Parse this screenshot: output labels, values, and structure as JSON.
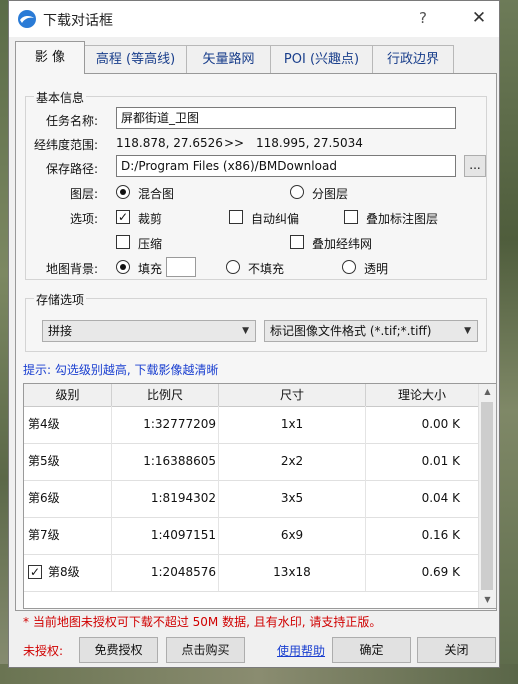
{
  "window": {
    "title": "下载对话框",
    "help_label": "?",
    "close_label": "✕"
  },
  "tabs": [
    {
      "label": "影 像"
    },
    {
      "label": "高程 (等高线)"
    },
    {
      "label": "矢量路网"
    },
    {
      "label": "POI (兴趣点)"
    },
    {
      "label": "行政边界"
    }
  ],
  "basic_info": {
    "legend": "基本信息",
    "task_name_label": "任务名称:",
    "task_name_value": "屏都街道_卫图",
    "range_label": "经纬度范围:",
    "range_from": "118.878, 27.6526",
    "range_sep": ">>",
    "range_to": "118.995, 27.5034",
    "save_path_label": "保存路径:",
    "save_path_value": "D:/Program Files (x86)/BMDownload",
    "browse_label": "...",
    "layer_label": "图层:",
    "layer_options": [
      {
        "label": "混合图",
        "selected": true
      },
      {
        "label": "分图层",
        "selected": false
      }
    ],
    "options_label": "选项:",
    "options": [
      {
        "label": "裁剪",
        "checked": true
      },
      {
        "label": "自动纠偏",
        "checked": false
      },
      {
        "label": "叠加标注图层",
        "checked": false
      },
      {
        "label": "压缩",
        "checked": false
      },
      {
        "label": "叠加经纬网",
        "checked": false
      }
    ],
    "background_label": "地图背景:",
    "background_options": [
      {
        "label": "填充",
        "selected": true
      },
      {
        "label": "不填充",
        "selected": false
      },
      {
        "label": "透明",
        "selected": false
      }
    ]
  },
  "storage": {
    "legend": "存储选项",
    "mode_value": "拼接",
    "format_value": "标记图像文件格式 (*.tif;*.tiff)"
  },
  "hint": "提示: 勾选级别越高, 下载影像越清晰",
  "table": {
    "columns": [
      "级别",
      "比例尺",
      "尺寸",
      "理论大小"
    ],
    "rows": [
      {
        "level": "第4级",
        "scale": "1:32777209",
        "size": "1x1",
        "est": "0.00 K",
        "checked": false,
        "has_check": false
      },
      {
        "level": "第5级",
        "scale": "1:16388605",
        "size": "2x2",
        "est": "0.01 K",
        "checked": false,
        "has_check": false
      },
      {
        "level": "第6级",
        "scale": "1:8194302",
        "size": "3x5",
        "est": "0.04 K",
        "checked": false,
        "has_check": false
      },
      {
        "level": "第7级",
        "scale": "1:4097151",
        "size": "6x9",
        "est": "0.16 K",
        "checked": false,
        "has_check": false
      },
      {
        "level": "第8级",
        "scale": "1:2048576",
        "size": "13x18",
        "est": "0.69 K",
        "checked": true,
        "has_check": true
      }
    ]
  },
  "footer": {
    "warning": "* 当前地图未授权可下载不超过 50M 数据, 且有水印, 请支持正版。",
    "unauth_label": "未授权:",
    "free_auth_label": "免费授权",
    "buy_label": "点击购买",
    "help_link": "使用帮助",
    "ok_label": "确定",
    "close_label": "关闭"
  },
  "colors": {
    "warning": "#d00000",
    "link": "#1a3fd0"
  }
}
